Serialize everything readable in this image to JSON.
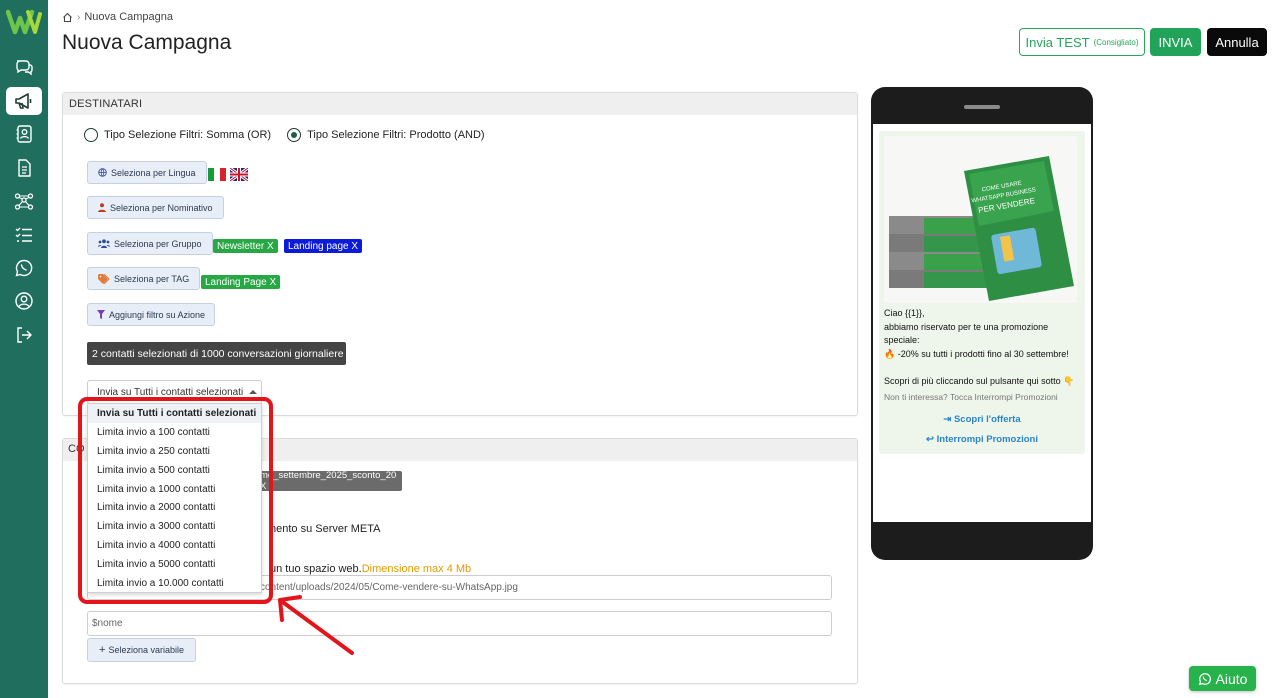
{
  "breadcrumb": {
    "current": "Nuova Campagna"
  },
  "page": {
    "title": "Nuova Campagna"
  },
  "actions": {
    "test_label": "Invia TEST",
    "test_hint": "(Consigliato)",
    "send_label": "INVIA",
    "cancel_label": "Annulla"
  },
  "sidebar": {
    "items": [
      {
        "icon": "chat-icon"
      },
      {
        "icon": "megaphone-icon",
        "active": true
      },
      {
        "icon": "contacts-icon"
      },
      {
        "icon": "document-icon"
      },
      {
        "icon": "workflow-icon"
      },
      {
        "icon": "checklist-icon"
      },
      {
        "icon": "whatsapp-icon"
      },
      {
        "icon": "user-circle-icon"
      },
      {
        "icon": "logout-icon"
      }
    ]
  },
  "recipients": {
    "header": "DESTINATARI",
    "radio_or": "Tipo Selezione Filtri: Somma (OR)",
    "radio_and": "Tipo Selezione Filtri: Prodotto (AND)",
    "by_language": "Seleziona per Lingua",
    "by_name": "Seleziona per Nominativo",
    "by_group": "Seleziona per Gruppo",
    "by_tag": "Seleziona per TAG",
    "by_action": "Aggiungi filtro su Azione",
    "group_tags": [
      "Newsletter X",
      "Landing page X"
    ],
    "tag_tags": [
      "Landing Page  X"
    ],
    "info": "2 contatti selezionati di 1000 conversazioni giornaliere",
    "select_value": "Invia su Tutti i contatti selezionati",
    "options": [
      "Invia su Tutti i contatti selezionati",
      "Limita invio a 100 contatti",
      "Limita invio a 250 contatti",
      "Limita invio a 500 contatti",
      "Limita invio a 1000 contatti",
      "Limita invio a 2000 contatti",
      "Limita invio a 3000 contatti",
      "Limita invio a 4000 contatti",
      "Limita invio a 5000 contatti",
      "Limita invio a 10.000 contatti"
    ]
  },
  "content": {
    "header_prefix": "CO",
    "template_tag": "mo_settembre_2025_sconto_20  X",
    "server_text": "nento su Server META",
    "web_text": "un tuo spazio web.",
    "web_max": "Dimensione max 4 Mb",
    "url_value": "content/uploads/2024/05/Come-vendere-su-WhatsApp.jpg",
    "var_value": "$nome",
    "var_button": "Seleziona variabile"
  },
  "preview": {
    "book_title_1": "COME USARE",
    "book_title_2": "WHATSAPP BUSINESS",
    "book_title_3": "PER VENDERE",
    "line1": "Ciao {{1}},",
    "line2": "abbiamo riservato per te una promozione speciale:",
    "line3": "🔥 -20% su tutti i prodotti fino al 30 settembre!",
    "line4": "Scopri di più cliccando sul pulsante qui sotto 👇",
    "footer": "Non ti interessa? Tocca Interrompi Promozioni",
    "btn_offer": "Scopri l'offerta",
    "btn_stop": "Interrompi Promozioni"
  },
  "help": {
    "label": "Aiuto"
  },
  "colors": {
    "sidebar": "#1f6e5e",
    "primary_green": "#22a35a",
    "highlight_red": "#e4141b",
    "tag_blue": "#0b1bd8"
  }
}
